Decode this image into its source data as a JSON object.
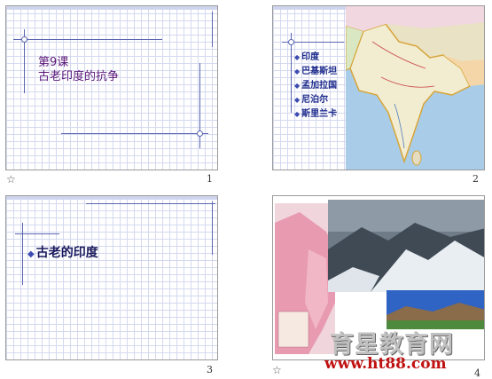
{
  "slides": [
    {
      "number": "1",
      "title_line1": "第9课",
      "title_line2": "古老印度的抗争",
      "has_star": true
    },
    {
      "number": "2",
      "items": [
        "印度",
        "巴基斯坦",
        "孟加拉国",
        "尼泊尔",
        "斯里兰卡"
      ]
    },
    {
      "number": "3",
      "heading": "古老的印度"
    },
    {
      "number": "4",
      "has_star": true
    }
  ],
  "watermark": {
    "line1": "育星教育网",
    "line2": "www.ht88.com"
  },
  "colors": {
    "grid": "#d5d9ef",
    "accent_line": "#5b67b0",
    "title": "#5a1778",
    "watermark_red": "#c01010"
  },
  "icons": {
    "slide_marker": "star-icon"
  }
}
